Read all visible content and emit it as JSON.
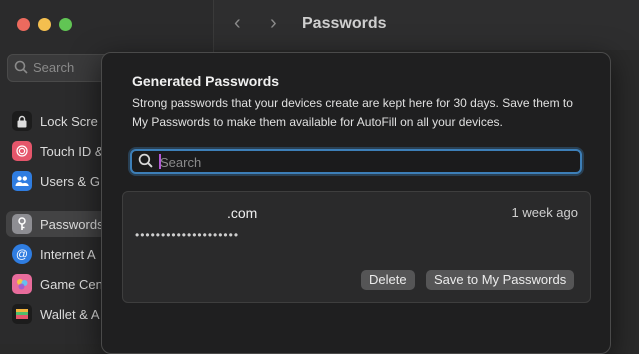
{
  "window": {
    "title": "Passwords"
  },
  "sidebar": {
    "search_placeholder": "Search",
    "items": [
      {
        "label": "Lock Scre",
        "icon": "lock-icon",
        "color": "#1c1c1c"
      },
      {
        "label": "Touch ID &",
        "icon": "fingerprint-icon",
        "color": "#e5566b"
      },
      {
        "label": "Users & G",
        "icon": "users-icon",
        "color": "#2f7de1"
      },
      {
        "label": "Passwords",
        "icon": "key-icon",
        "color": "#8e8e93"
      },
      {
        "label": "Internet A",
        "icon": "at-icon",
        "color": "#2f7de1"
      },
      {
        "label": "Game Cen",
        "icon": "game-center-icon",
        "color": "#e86c9c"
      },
      {
        "label": "Wallet & A",
        "icon": "wallet-icon",
        "color": "#1c1c1c"
      }
    ]
  },
  "sheet": {
    "title": "Generated Passwords",
    "description": "Strong passwords that your devices create are kept here for 30 days. Save them to My Passwords to make them available for AutoFill on all your devices.",
    "search_placeholder": "Search",
    "entries": [
      {
        "site_suffix": ".com",
        "age": "1 week ago",
        "password_mask": "••••••••••••••••••••",
        "delete_label": "Delete",
        "save_label": "Save to My Passwords"
      }
    ]
  },
  "colors": {
    "accent": "#3d7fb8",
    "sheet_bg": "#1f1f20",
    "button_bg": "#555556"
  }
}
